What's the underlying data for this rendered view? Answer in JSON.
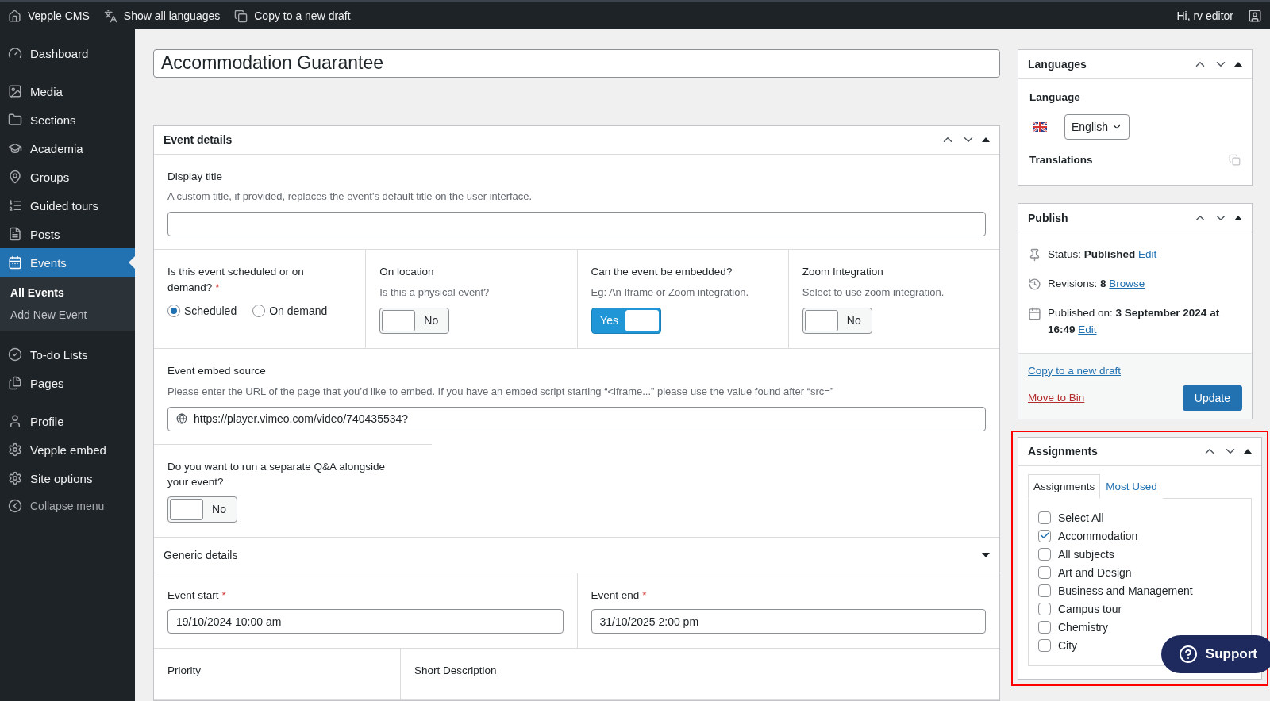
{
  "admin_bar": {
    "items": [
      {
        "label": "Vepple CMS"
      },
      {
        "label": "Show all languages"
      },
      {
        "label": "Copy to a new draft"
      }
    ],
    "greeting": "Hi, rv editor"
  },
  "sidebar": {
    "items": [
      {
        "label": "Dashboard",
        "selected": false
      },
      {
        "label": "Media",
        "selected": false
      },
      {
        "label": "Sections",
        "selected": false
      },
      {
        "label": "Academia",
        "selected": false
      },
      {
        "label": "Groups",
        "selected": false
      },
      {
        "label": "Guided tours",
        "selected": false
      },
      {
        "label": "Posts",
        "selected": false
      },
      {
        "label": "Events",
        "selected": true,
        "children": [
          {
            "label": "All Events",
            "selected": true
          },
          {
            "label": "Add New Event",
            "selected": false
          }
        ]
      },
      {
        "label": "To-do Lists",
        "selected": false
      },
      {
        "label": "Pages",
        "selected": false
      },
      {
        "label": "Profile",
        "selected": false
      },
      {
        "label": "Vepple embed",
        "selected": false
      },
      {
        "label": "Site options",
        "selected": false
      }
    ],
    "collapse": "Collapse menu"
  },
  "title_field": {
    "value": "Accommodation Guarantee"
  },
  "event_details": {
    "title": "Event details",
    "display_title": {
      "label": "Display title",
      "help": "A custom title, if provided, replaces the event's default title on the user interface."
    },
    "options": [
      {
        "kind": "radio",
        "label": "Is this event scheduled or on demand?",
        "required_mark": "*",
        "choices": [
          {
            "label": "Scheduled",
            "selected": true
          },
          {
            "label": "On demand",
            "selected": false
          }
        ]
      },
      {
        "kind": "toggle",
        "label": "On location",
        "help": "Is this a physical event?",
        "on": false,
        "state_label": "No"
      },
      {
        "kind": "toggle",
        "label": "Can the event be embedded?",
        "help": "Eg: An Iframe or Zoom integration.",
        "on": true,
        "state_label": "Yes"
      },
      {
        "kind": "toggle",
        "label": "Zoom Integration",
        "help": "Select to use zoom integration.",
        "on": false,
        "state_label": "No"
      }
    ],
    "embed_source": {
      "label": "Event embed source",
      "help": "Please enter the URL of the page that you’d like to embed. If you have an embed script starting “<iframe...” please use the value found after “src=”",
      "value": "https://player.vimeo.com/video/740435534?"
    },
    "qa": {
      "label": "Do you want to run a separate Q&A alongside your event?",
      "on": false,
      "state_label": "No"
    }
  },
  "generic_details": {
    "title": "Generic details",
    "expanded": true,
    "dates": [
      {
        "label": "Event start",
        "required_mark": "*",
        "value": "19/10/2024 10:00 am"
      },
      {
        "label": "Event end",
        "required_mark": "*",
        "value": "31/10/2025 2:00 pm"
      }
    ],
    "bottom": [
      {
        "label": "Priority"
      },
      {
        "label": "Short Description"
      }
    ]
  },
  "languages": {
    "title": "Languages",
    "language_label": "Language",
    "language": "English",
    "translations_label": "Translations"
  },
  "publish": {
    "title": "Publish",
    "lines": [
      {
        "text": "Status: **Published**",
        "link": "Edit"
      },
      {
        "text": "Revisions: **8**",
        "link": "Browse"
      },
      {
        "text": "Published on: **3 September 2024 at 16:49**",
        "link": "Edit"
      }
    ],
    "copy_link": "Copy to a new draft",
    "trash_link": "Move to Bin",
    "update": "Update"
  },
  "assignments": {
    "title": "Assignments",
    "highlighted": true,
    "tabs": [
      {
        "label": "Assignments",
        "selected": true
      },
      {
        "label": "Most Used",
        "selected": false
      }
    ],
    "items": [
      {
        "label": "Select All",
        "checked": false
      },
      {
        "label": "Accommodation",
        "checked": true
      },
      {
        "label": "All subjects",
        "checked": false
      },
      {
        "label": "Art and Design",
        "checked": false
      },
      {
        "label": "Business and Management",
        "checked": false
      },
      {
        "label": "Campus tour",
        "checked": false
      },
      {
        "label": "Chemistry",
        "checked": false
      },
      {
        "label": "City",
        "checked": false
      }
    ]
  },
  "support": {
    "label": "Support"
  }
}
